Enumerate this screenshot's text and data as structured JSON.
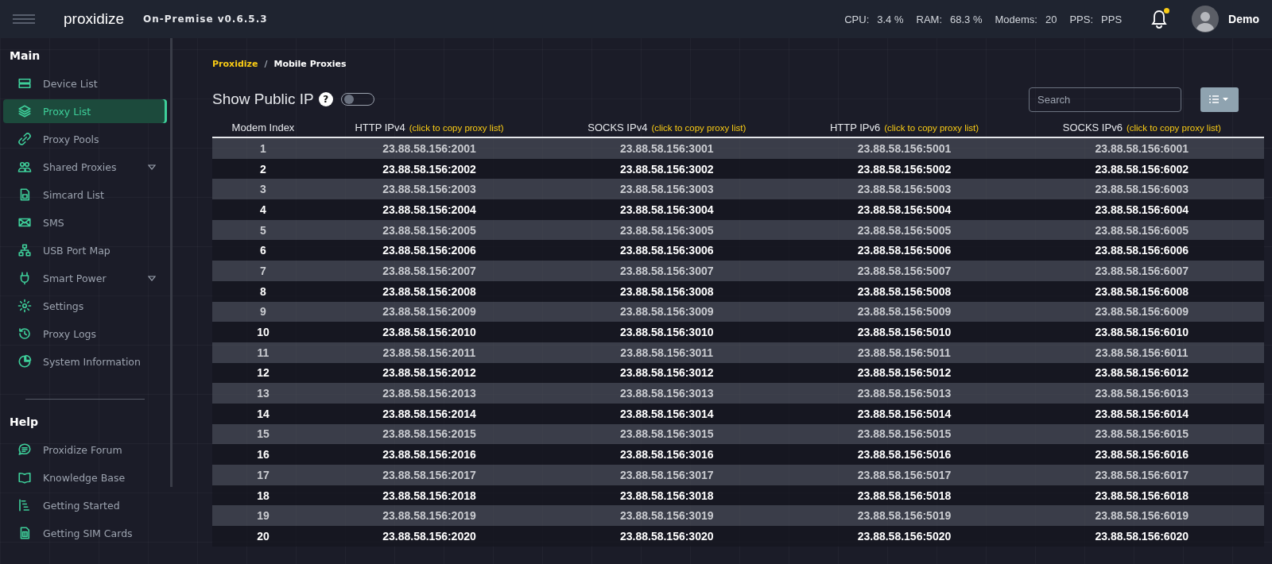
{
  "header": {
    "logo": "proxidize",
    "version": "On-Premise v0.6.5.3",
    "stats": [
      {
        "label": "CPU:",
        "value": "3.4 %"
      },
      {
        "label": "RAM:",
        "value": "68.3 %"
      },
      {
        "label": "Modems:",
        "value": "20"
      },
      {
        "label": "PPS:",
        "value": "PPS"
      }
    ],
    "notifications": {
      "unread": true
    },
    "user": "Demo"
  },
  "sidebar": {
    "sections": [
      {
        "title": "Main",
        "items": [
          {
            "label": "Device List",
            "selected": false,
            "submenu": false
          },
          {
            "label": "Proxy List",
            "selected": true,
            "submenu": false
          },
          {
            "label": "Proxy Pools",
            "selected": false,
            "submenu": false
          },
          {
            "label": "Shared Proxies",
            "selected": false,
            "submenu": true
          },
          {
            "label": "Simcard List",
            "selected": false,
            "submenu": false
          },
          {
            "label": "SMS",
            "selected": false,
            "submenu": false
          },
          {
            "label": "USB Port Map",
            "selected": false,
            "submenu": false
          },
          {
            "label": "Smart Power",
            "selected": false,
            "submenu": true
          },
          {
            "label": "Settings",
            "selected": false,
            "submenu": false
          },
          {
            "label": "Proxy Logs",
            "selected": false,
            "submenu": false
          },
          {
            "label": "System Information",
            "selected": false,
            "submenu": false
          }
        ]
      },
      {
        "title": "Help",
        "items": [
          {
            "label": "Proxidize Forum",
            "selected": false,
            "submenu": false
          },
          {
            "label": "Knowledge Base",
            "selected": false,
            "submenu": false
          },
          {
            "label": "Getting Started",
            "selected": false,
            "submenu": false
          },
          {
            "label": "Getting SIM Cards",
            "selected": false,
            "submenu": false
          }
        ]
      }
    ]
  },
  "breadcrumb": {
    "items": [
      "Proxidize",
      "Mobile Proxies"
    ],
    "separator": "/"
  },
  "show_public_ip": {
    "label": "Show Public IP",
    "help": "?",
    "on": false
  },
  "search": {
    "placeholder": "Search"
  },
  "table": {
    "columns": [
      {
        "label": "Modem Index"
      },
      {
        "label": "HTTP IPv4",
        "hint": "(click to copy proxy list)"
      },
      {
        "label": "SOCKS IPv4",
        "hint": "(click to copy proxy list)"
      },
      {
        "label": "HTTP IPv6",
        "hint": "(click to copy proxy list)"
      },
      {
        "label": "SOCKS IPv6",
        "hint": "(click to copy proxy list)"
      }
    ],
    "rows": [
      [
        "1",
        "23.88.58.156:2001",
        "23.88.58.156:3001",
        "23.88.58.156:5001",
        "23.88.58.156:6001"
      ],
      [
        "2",
        "23.88.58.156:2002",
        "23.88.58.156:3002",
        "23.88.58.156:5002",
        "23.88.58.156:6002"
      ],
      [
        "3",
        "23.88.58.156:2003",
        "23.88.58.156:3003",
        "23.88.58.156:5003",
        "23.88.58.156:6003"
      ],
      [
        "4",
        "23.88.58.156:2004",
        "23.88.58.156:3004",
        "23.88.58.156:5004",
        "23.88.58.156:6004"
      ],
      [
        "5",
        "23.88.58.156:2005",
        "23.88.58.156:3005",
        "23.88.58.156:5005",
        "23.88.58.156:6005"
      ],
      [
        "6",
        "23.88.58.156:2006",
        "23.88.58.156:3006",
        "23.88.58.156:5006",
        "23.88.58.156:6006"
      ],
      [
        "7",
        "23.88.58.156:2007",
        "23.88.58.156:3007",
        "23.88.58.156:5007",
        "23.88.58.156:6007"
      ],
      [
        "8",
        "23.88.58.156:2008",
        "23.88.58.156:3008",
        "23.88.58.156:5008",
        "23.88.58.156:6008"
      ],
      [
        "9",
        "23.88.58.156:2009",
        "23.88.58.156:3009",
        "23.88.58.156:5009",
        "23.88.58.156:6009"
      ],
      [
        "10",
        "23.88.58.156:2010",
        "23.88.58.156:3010",
        "23.88.58.156:5010",
        "23.88.58.156:6010"
      ],
      [
        "11",
        "23.88.58.156:2011",
        "23.88.58.156:3011",
        "23.88.58.156:5011",
        "23.88.58.156:6011"
      ],
      [
        "12",
        "23.88.58.156:2012",
        "23.88.58.156:3012",
        "23.88.58.156:5012",
        "23.88.58.156:6012"
      ],
      [
        "13",
        "23.88.58.156:2013",
        "23.88.58.156:3013",
        "23.88.58.156:5013",
        "23.88.58.156:6013"
      ],
      [
        "14",
        "23.88.58.156:2014",
        "23.88.58.156:3014",
        "23.88.58.156:5014",
        "23.88.58.156:6014"
      ],
      [
        "15",
        "23.88.58.156:2015",
        "23.88.58.156:3015",
        "23.88.58.156:5015",
        "23.88.58.156:6015"
      ],
      [
        "16",
        "23.88.58.156:2016",
        "23.88.58.156:3016",
        "23.88.58.156:5016",
        "23.88.58.156:6016"
      ],
      [
        "17",
        "23.88.58.156:2017",
        "23.88.58.156:3017",
        "23.88.58.156:5017",
        "23.88.58.156:6017"
      ],
      [
        "18",
        "23.88.58.156:2018",
        "23.88.58.156:3018",
        "23.88.58.156:5018",
        "23.88.58.156:6018"
      ],
      [
        "19",
        "23.88.58.156:2019",
        "23.88.58.156:3019",
        "23.88.58.156:5019",
        "23.88.58.156:6019"
      ],
      [
        "20",
        "23.88.58.156:2020",
        "23.88.58.156:3020",
        "23.88.58.156:5020",
        "23.88.58.156:6020"
      ]
    ]
  }
}
